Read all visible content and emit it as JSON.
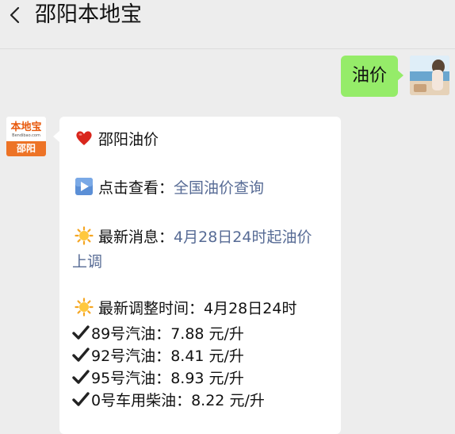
{
  "header": {
    "title": "邵阳本地宝",
    "back_icon": "chevron-left-icon"
  },
  "sent_message": {
    "text": "油价",
    "bubble_color": "#95ec69"
  },
  "bot": {
    "logo_text": "本地宝",
    "logo_sub": "Bendibao.com",
    "logo_city": "邵阳",
    "accent_color": "#ed7326"
  },
  "reply": {
    "title": "邵阳油价",
    "title_icon": "heart-icon",
    "check_prefix": "点击查看：",
    "check_link": "全国油价查询",
    "check_icon": "play-button-icon",
    "news_prefix": "最新消息：",
    "news_link_line1": "4月28日24时起油价",
    "news_link_line2": "上调",
    "news_icon": "sun-icon",
    "adjust_label": "最新调整时间：4月28日24时",
    "adjust_icon": "sun-icon",
    "prices": [
      {
        "name": "89号汽油：",
        "value": "7.88 元/升"
      },
      {
        "name": "92号汽油：",
        "value": "8.41 元/升"
      },
      {
        "name": "95号汽油：",
        "value": "8.93 元/升"
      },
      {
        "name": "0号车用柴油：",
        "value": "8.22 元/升"
      }
    ],
    "price_icon": "checkmark-icon",
    "link_color": "#576b95"
  }
}
